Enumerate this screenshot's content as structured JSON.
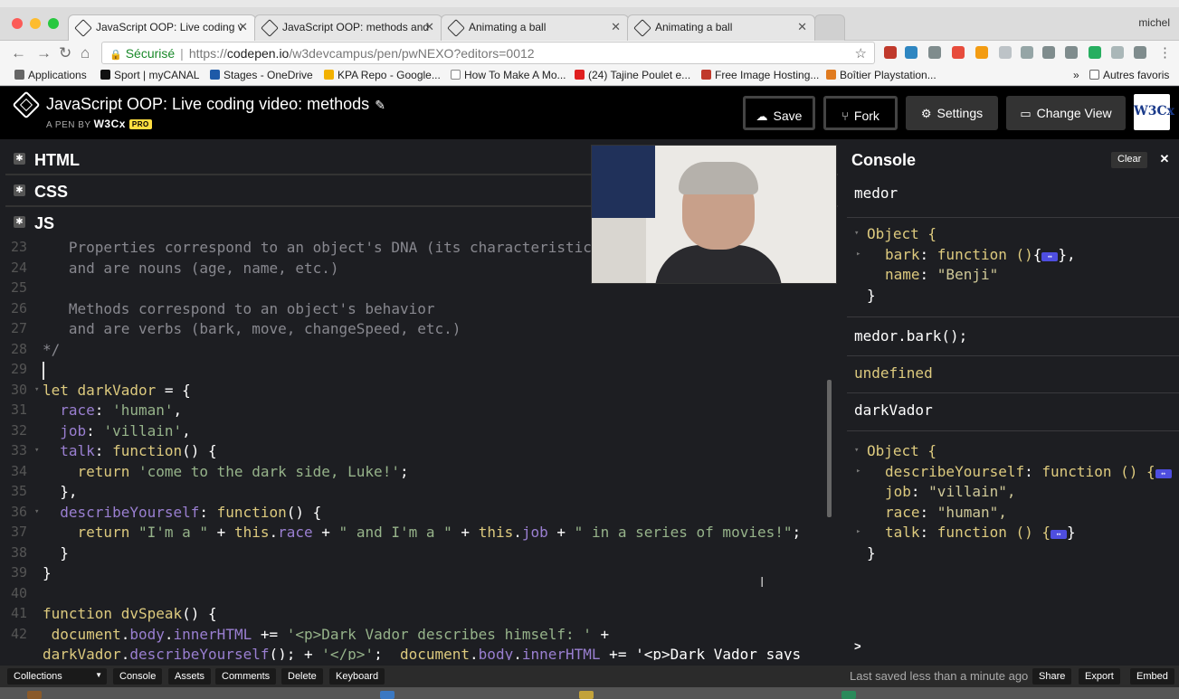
{
  "browser": {
    "profile_name": "michel",
    "tabs": [
      {
        "title": "JavaScript OOP: Live coding v",
        "active": true
      },
      {
        "title": "JavaScript OOP: methods and",
        "active": false
      },
      {
        "title": "Animating a ball",
        "active": false
      },
      {
        "title": "Animating a ball",
        "active": false
      }
    ],
    "address": {
      "secure_label": "Sécurisé",
      "url_scheme": "https://",
      "url_host": "codepen.io",
      "url_path": "/w3devcampus/pen/pwNEXO?editors=0012"
    },
    "bookmarks": [
      {
        "label": "Applications",
        "icon": "apps-grid-icon",
        "color": "#666666"
      },
      {
        "label": "Sport | myCANAL",
        "icon": "plus-icon",
        "color": "#111111"
      },
      {
        "label": "Stages - OneDrive",
        "icon": "cloud-icon",
        "color": "#1e5aa8"
      },
      {
        "label": "KPA Repo - Google...",
        "icon": "drive-icon",
        "color": "#f2b100"
      },
      {
        "label": "How To Make A Mo...",
        "icon": "page-icon",
        "color": "#ffffff"
      },
      {
        "label": "(24) Tajine Poulet e...",
        "icon": "youtube-icon",
        "color": "#e02020"
      },
      {
        "label": "Free Image Hosting...",
        "icon": "page-icon",
        "color": "#c0392b"
      },
      {
        "label": "Boîtier Playstation...",
        "icon": "page-icon",
        "color": "#e07b20"
      }
    ],
    "bookmarks_overflow": "»",
    "other_bookmarks": "Autres favoris"
  },
  "pen": {
    "title": "JavaScript OOP: Live coding video: methods",
    "by_label": "A PEN BY",
    "author": "W3Cx",
    "pro_badge": "PRO",
    "buttons": {
      "save": "Save",
      "fork": "Fork",
      "settings": "Settings",
      "change_view": "Change View"
    },
    "avatar_text": "W3Cx"
  },
  "editors": {
    "html_label": "HTML",
    "css_label": "CSS",
    "js_label": "JS"
  },
  "code_lines": [
    {
      "n": "23",
      "text": "   Properties correspond to an object's DNA (its characteristics)"
    },
    {
      "n": "24",
      "text": "   and are nouns (age, name, etc.)"
    },
    {
      "n": "25",
      "text": ""
    },
    {
      "n": "26",
      "text": "   Methods correspond to an object's behavior"
    },
    {
      "n": "27",
      "text": "   and are verbs (bark, move, changeSpeed, etc.)"
    },
    {
      "n": "28",
      "text": "*/"
    },
    {
      "n": "29",
      "text": ""
    },
    {
      "n": "30",
      "text": "let darkVador = {"
    },
    {
      "n": "31",
      "text": "  race: 'human',"
    },
    {
      "n": "32",
      "text": "  job: 'villain',"
    },
    {
      "n": "33",
      "text": "  talk: function() {"
    },
    {
      "n": "34",
      "text": "    return 'come to the dark side, Luke!';"
    },
    {
      "n": "35",
      "text": "  },"
    },
    {
      "n": "36",
      "text": "  describeYourself: function() {"
    },
    {
      "n": "37",
      "text": "    return \"I'm a \" + this.race + \" and I'm a \" + this.job + \" in a series of movies!\";"
    },
    {
      "n": "38",
      "text": "  }"
    },
    {
      "n": "39",
      "text": "}"
    },
    {
      "n": "40",
      "text": ""
    },
    {
      "n": "41",
      "text": "function dvSpeak() {"
    },
    {
      "n": "42",
      "text": " document.body.innerHTML += '<p>Dark Vador describes himself: ' +"
    },
    {
      "n": "",
      "text": "darkVador.describeYourself(); + '</p>';  document.body.innerHTML += '<p>Dark Vador says"
    }
  ],
  "console": {
    "title": "Console",
    "clear_label": "Clear",
    "close_glyph": "✕",
    "prompt": ">",
    "entries": {
      "e1_input": "medor",
      "e1_obj_open": "Object {",
      "e1_prop1_key": "bark",
      "e1_prop1_val": "function ()",
      "e1_prop1_tail": "},",
      "e1_prop2_key": "name",
      "e1_prop2_val": "\"Benji\"",
      "e1_obj_close": "}",
      "e2_input": "medor.bark();",
      "e2_result": "undefined",
      "e3_input": "darkVador",
      "e3_obj_open": "Object {",
      "e3_prop1_key": "describeYourself",
      "e3_prop1_val": "function () {",
      "e3_prop2_key": "job",
      "e3_prop2_val": "\"villain\",",
      "e3_prop3_key": "race",
      "e3_prop3_val": "\"human\",",
      "e3_prop4_key": "talk",
      "e3_prop4_val": "function () {",
      "e3_prop4_tail": "}",
      "e3_obj_close": "}"
    }
  },
  "footer": {
    "collections": "Collections",
    "console": "Console",
    "assets": "Assets",
    "comments": "Comments",
    "delete": "Delete",
    "keyboard": "Keyboard",
    "last_saved": "Last saved less than a minute ago",
    "share": "Share",
    "export": "Export",
    "embed": "Embed"
  },
  "colors": {
    "keyword": "#ddca7e",
    "property": "#9a7fd1",
    "string": "#96b38a",
    "comment": "#88888f"
  }
}
